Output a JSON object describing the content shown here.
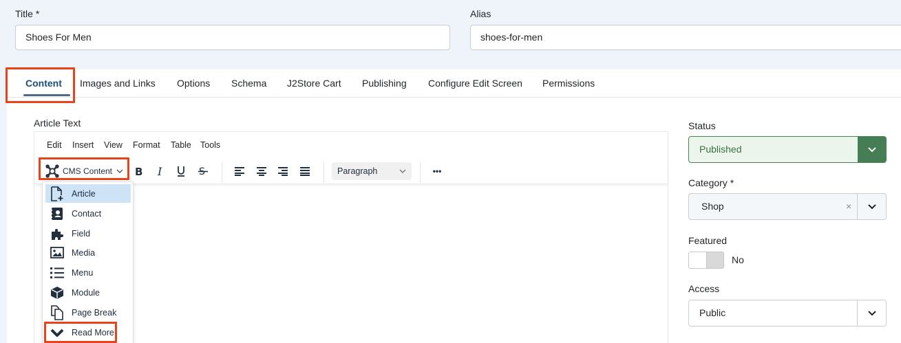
{
  "title_field": {
    "label": "Title *",
    "value": "Shoes For Men"
  },
  "alias_field": {
    "label": "Alias",
    "value": "shoes-for-men"
  },
  "tabs": [
    {
      "label": "Content"
    },
    {
      "label": "Images and Links"
    },
    {
      "label": "Options"
    },
    {
      "label": "Schema"
    },
    {
      "label": "J2Store Cart"
    },
    {
      "label": "Publishing"
    },
    {
      "label": "Configure Edit Screen"
    },
    {
      "label": "Permissions"
    }
  ],
  "editor": {
    "label": "Article Text",
    "menu": [
      "Edit",
      "Insert",
      "View",
      "Format",
      "Table",
      "Tools"
    ],
    "cms_content_label": "CMS Content",
    "paragraph_label": "Paragraph",
    "more_label": "•••",
    "dropdown_items": [
      {
        "label": "Article",
        "icon": "new-document-icon"
      },
      {
        "label": "Contact",
        "icon": "contact-card-icon"
      },
      {
        "label": "Field",
        "icon": "puzzle-icon"
      },
      {
        "label": "Media",
        "icon": "image-icon"
      },
      {
        "label": "Menu",
        "icon": "list-icon"
      },
      {
        "label": "Module",
        "icon": "cube-icon"
      },
      {
        "label": "Page Break",
        "icon": "page-break-icon"
      },
      {
        "label": "Read More",
        "icon": "chevron-down-icon"
      }
    ]
  },
  "sidebar": {
    "status": {
      "label": "Status",
      "value": "Published"
    },
    "category": {
      "label": "Category *",
      "value": "Shop",
      "clear": "×"
    },
    "featured": {
      "label": "Featured",
      "value": "No"
    },
    "access": {
      "label": "Access",
      "value": "Public"
    }
  },
  "colors": {
    "highlight": "#e8441b",
    "status_green": "#457d54",
    "active_tab": "#1d4f7a"
  }
}
